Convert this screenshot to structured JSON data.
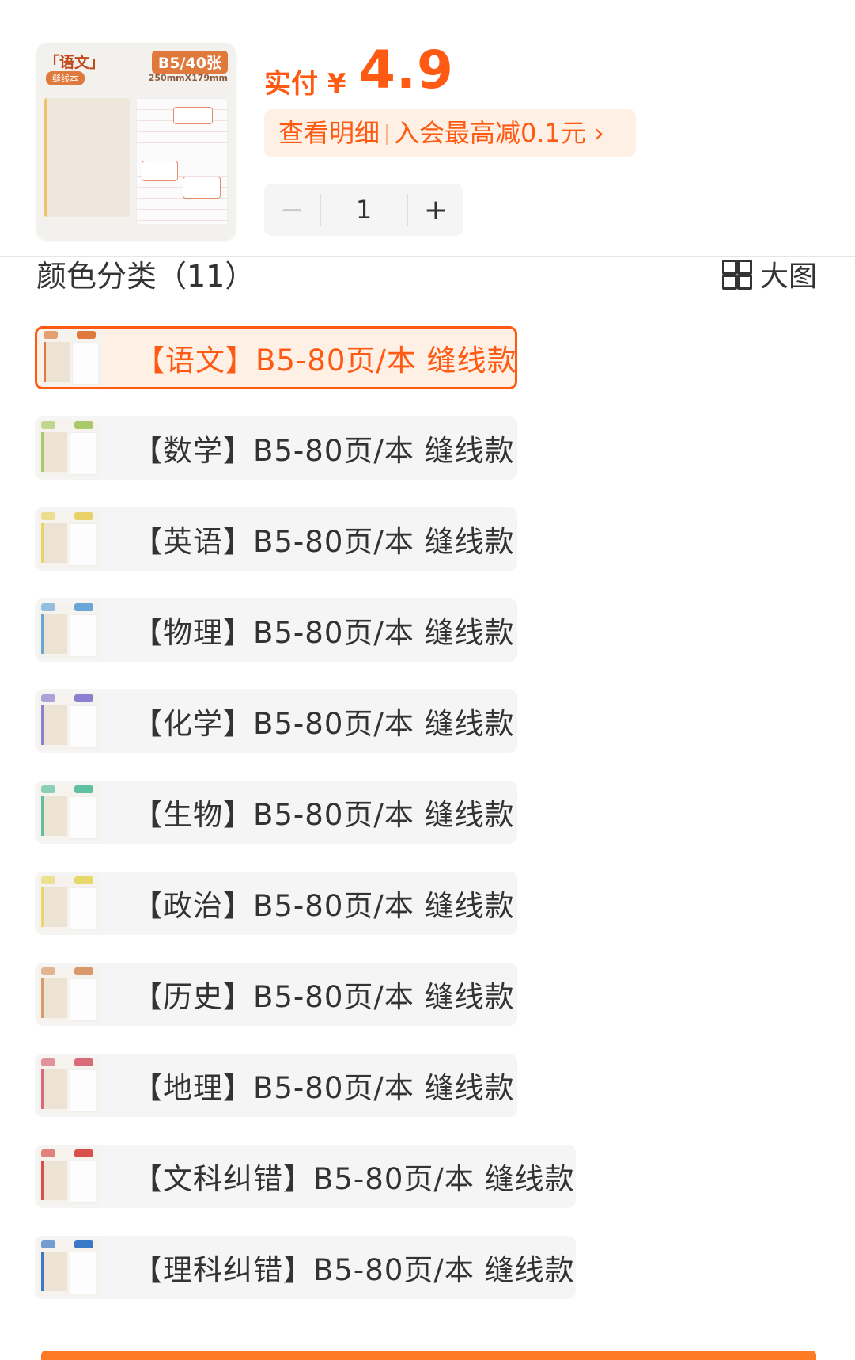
{
  "product": {
    "thumbnail": {
      "subject": "「语文」",
      "binding": "缝线本",
      "size": "B5/40张",
      "dimensions": "250mmX179mm"
    },
    "price_prefix": "实付 ¥",
    "price_value": "4.9",
    "promo_detail": "查看明细",
    "promo_member": "入会最高减0.1元",
    "promo_arrow": "›",
    "quantity": {
      "minus": "−",
      "value": "1",
      "plus": "+"
    }
  },
  "section": {
    "title": "颜色分类（11）",
    "big_view_label": "大图",
    "big_view_icon": "grid-icon"
  },
  "options": [
    {
      "label": "【语文】B5-80页/本 缝线款",
      "selected": true,
      "accent": "#e07a3c"
    },
    {
      "label": "【数学】B5-80页/本 缝线款",
      "selected": false,
      "accent": "#a9c96a"
    },
    {
      "label": "【英语】B5-80页/本 缝线款",
      "selected": false,
      "accent": "#e8d36a"
    },
    {
      "label": "【物理】B5-80页/本 缝线款",
      "selected": false,
      "accent": "#6aa6d8"
    },
    {
      "label": "【化学】B5-80页/本 缝线款",
      "selected": false,
      "accent": "#8a7fd0"
    },
    {
      "label": "【生物】B5-80页/本 缝线款",
      "selected": false,
      "accent": "#5fbfa3"
    },
    {
      "label": "【政治】B5-80页/本 缝线款",
      "selected": false,
      "accent": "#e6d86a"
    },
    {
      "label": "【历史】B5-80页/本 缝线款",
      "selected": false,
      "accent": "#d89a6a"
    },
    {
      "label": "【地理】B5-80页/本 缝线款",
      "selected": false,
      "accent": "#d86a7a"
    },
    {
      "label": "【文科纠错】B5-80页/本 缝线款",
      "selected": false,
      "accent": "#d8504a"
    },
    {
      "label": "【理科纠错】B5-80页/本 缝线款",
      "selected": false,
      "accent": "#3a78c8"
    }
  ],
  "colors": {
    "accent": "#ff5a13",
    "promo_bg": "#fff0e6",
    "option_bg": "#f5f5f5"
  }
}
